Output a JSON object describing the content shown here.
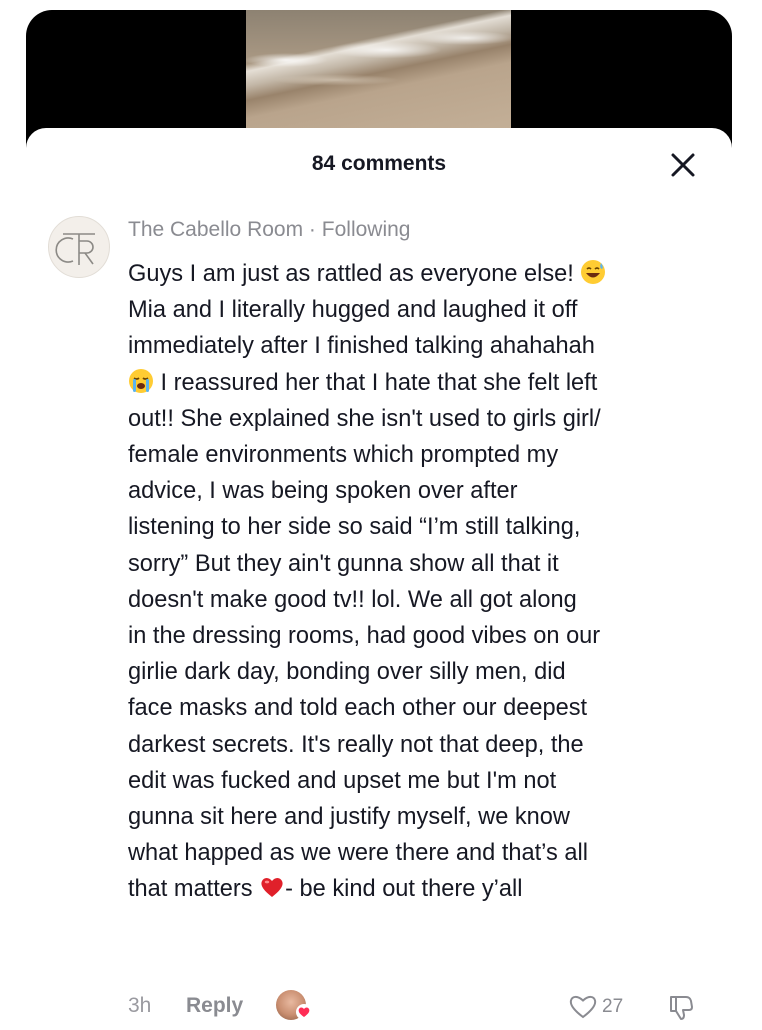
{
  "header": {
    "comment_count": "84 comments",
    "close_icon": "close-icon"
  },
  "comment": {
    "author": "The Cabello Room",
    "separator": " · ",
    "relation": "Following",
    "avatar_monogram": "TCR",
    "text_part1": "Guys I am just as rattled as everyone else! ",
    "emoji1": "sweat-smile-emoji",
    "text_part2": "\nMia and I literally hugged and laughed it off\nimmediately after I finished talking ahahahah\n",
    "emoji2": "crying-emoji",
    "text_part3": " I reassured her that I hate that she felt left\nout!! She explained she isn't used to girls girl/\nfemale environments which prompted my\nadvice, I was being spoken over after\nlistening to her side so said “I’m still talking,\nsorry” But they ain't gunna show all that it\ndoesn't make good tv!! lol. We all got along\nin the dressing rooms, had good vibes on our\ngirlie dark day, bonding over silly men, did\nface masks and told each other our deepest\ndarkest secrets. It's really not that deep, the\nedit was fucked and upset me but I'm not\ngunna sit here and justify myself, we know\nwhat happed as we were there and that’s all\nthat matters ",
    "emoji3": "red-heart-emoji",
    "text_part4": "- be kind out there y’all",
    "time": "3h",
    "reply_label": "Reply",
    "like_count": "27",
    "accent_heart": "#ff2d55",
    "text_color": "#161823",
    "muted_color": "#8a8b91"
  }
}
